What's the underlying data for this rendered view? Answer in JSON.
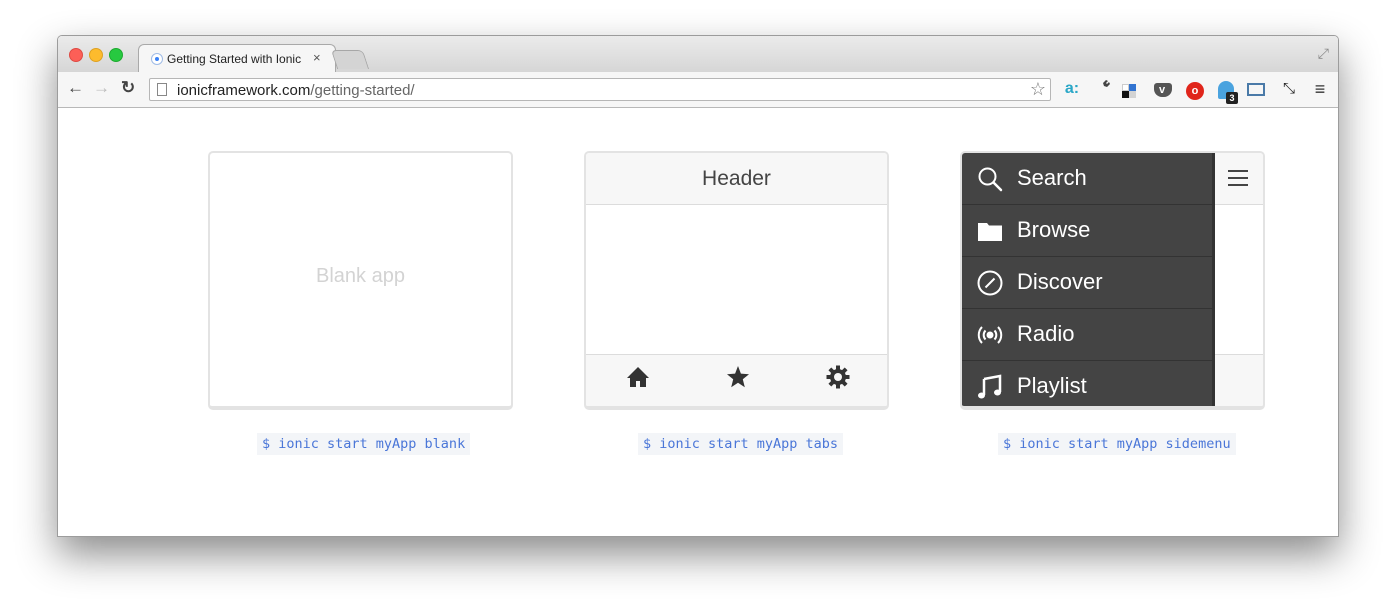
{
  "browser": {
    "tab_title": "Getting Started with Ionic",
    "tab_close": "×",
    "url_host": "ionicframework.com",
    "url_path": "/getting-started/",
    "extensions": {
      "amazon": "a:",
      "adblock_badge": "3"
    }
  },
  "cards": {
    "blank": {
      "label": "Blank app",
      "command": "$ ionic start myApp blank"
    },
    "tabs": {
      "header": "Header",
      "tab_icons": [
        "home-icon",
        "star-icon",
        "gear-icon"
      ],
      "command": "$ ionic start myApp tabs"
    },
    "sidemenu": {
      "items": [
        {
          "icon": "search-icon",
          "label": "Search"
        },
        {
          "icon": "folder-icon",
          "label": "Browse"
        },
        {
          "icon": "compass-icon",
          "label": "Discover"
        },
        {
          "icon": "radio-icon",
          "label": "Radio"
        },
        {
          "icon": "music-note-icon",
          "label": "Playlist"
        }
      ],
      "command": "$ ionic start myApp sidemenu"
    }
  },
  "colors": {
    "menu_background": "#444444",
    "command_text": "#4a76d8",
    "command_background": "#f3f5f8"
  }
}
